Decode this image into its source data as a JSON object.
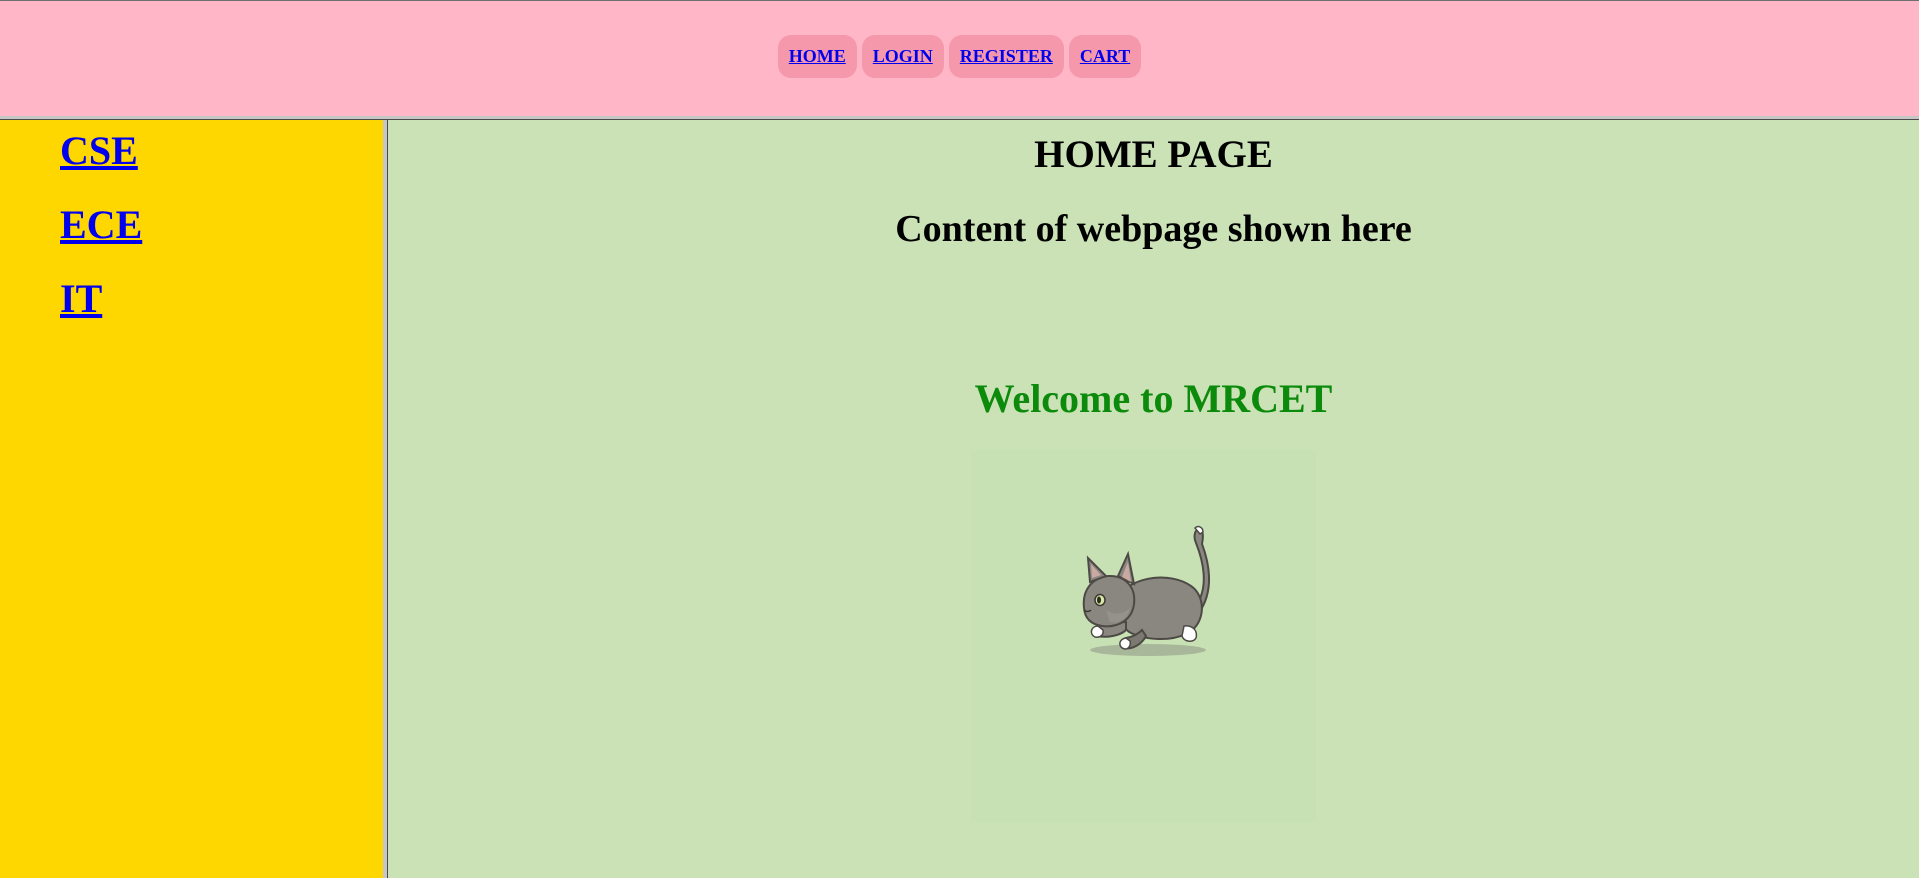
{
  "topnav": {
    "items": [
      {
        "label": "HOME"
      },
      {
        "label": "LOGIN"
      },
      {
        "label": "REGISTER"
      },
      {
        "label": "CART"
      }
    ]
  },
  "sidebar": {
    "items": [
      {
        "label": "CSE"
      },
      {
        "label": "ECE"
      },
      {
        "label": "IT"
      }
    ]
  },
  "main": {
    "title": "HOME PAGE",
    "subtitle": "Content of webpage shown here",
    "welcome": "Welcome to MRCET",
    "image_icon": "running-cat-icon"
  },
  "colors": {
    "top_bg": "#ffb6c6",
    "nav_pill": "#f598ac",
    "sidebar_bg": "#ffd700",
    "main_bg": "#cae2b5",
    "link": "#0000ee",
    "welcome": "#0b8a0b"
  }
}
